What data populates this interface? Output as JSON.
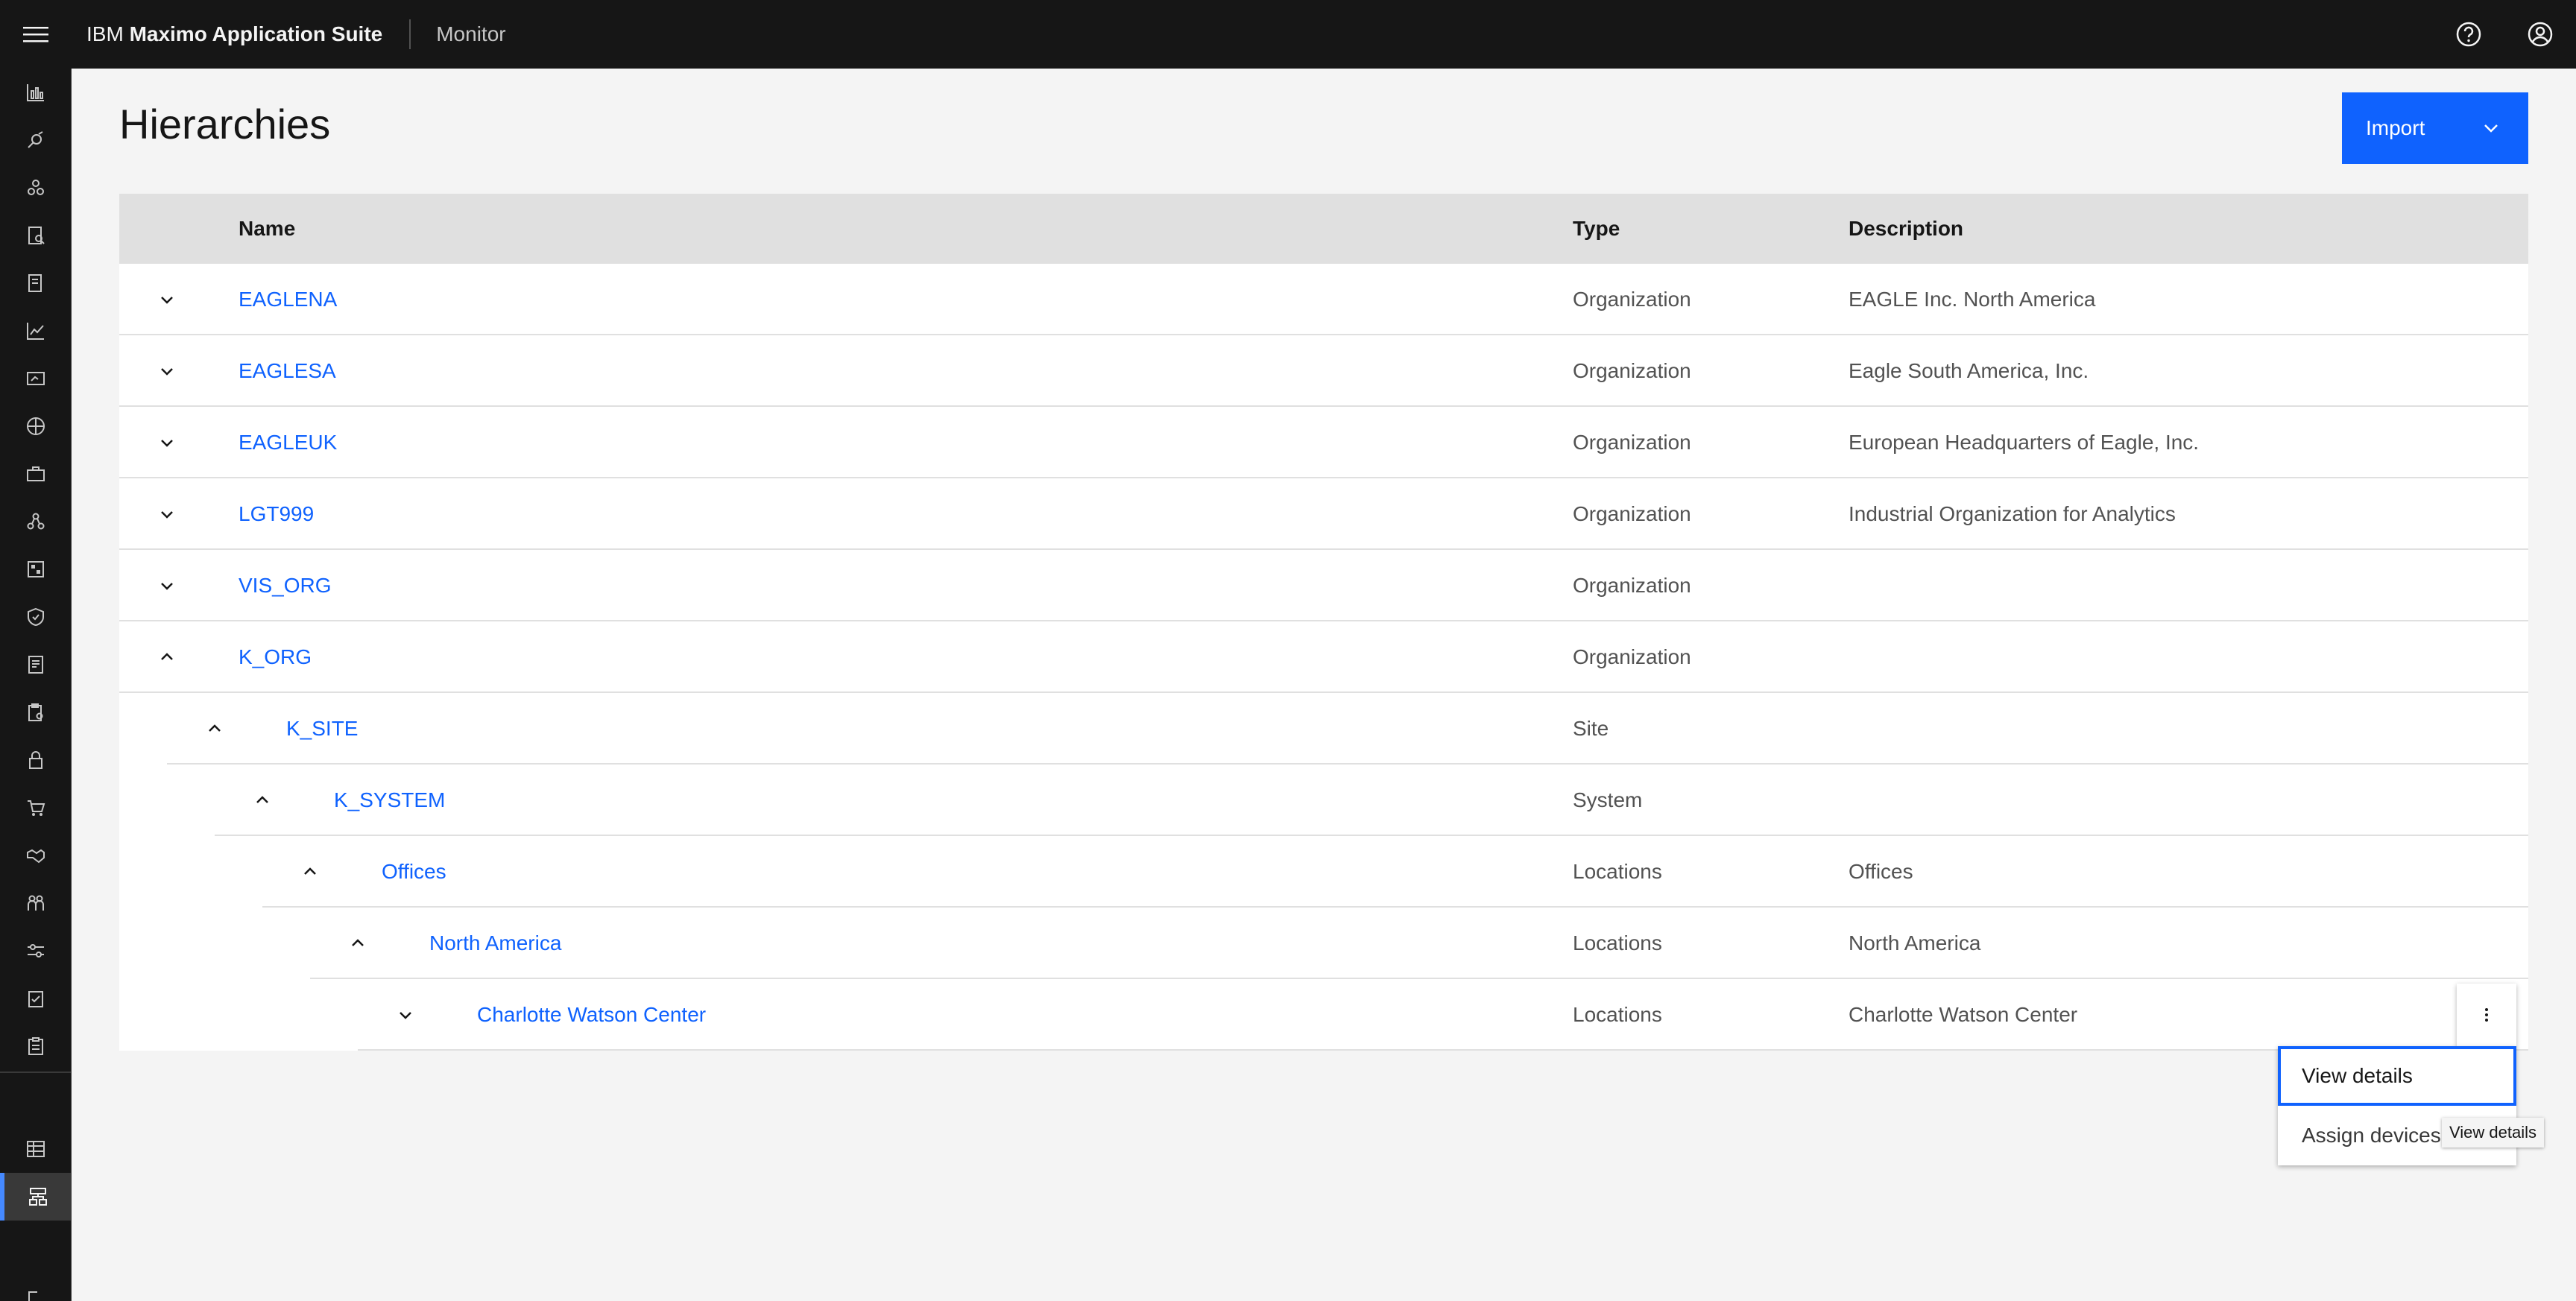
{
  "header": {
    "brand_prefix": "IBM",
    "brand_name": "Maximo Application Suite",
    "app_name": "Monitor",
    "icons": [
      "menu-icon",
      "help-icon",
      "user-avatar-icon"
    ]
  },
  "sidenav": {
    "icons": [
      "analytics-icon",
      "satellite-icon",
      "asset-icon",
      "inspection-icon",
      "report-icon",
      "chart-line-icon",
      "dashboard-icon",
      "network-icon",
      "tool-kit-icon",
      "model-icon",
      "grid-icon",
      "security-icon",
      "document-icon",
      "clipboard-icon",
      "lock-icon",
      "cart-icon",
      "handshake-icon",
      "people-icon",
      "settings-adjust-icon",
      "checklist-icon",
      "task-icon",
      "data-table-icon",
      "hierarchy-icon",
      "logout-icon"
    ],
    "active": "hierarchy-icon"
  },
  "page": {
    "title": "Hierarchies",
    "import_label": "Import"
  },
  "table": {
    "columns": {
      "name": "Name",
      "type": "Type",
      "description": "Description"
    },
    "rows": [
      {
        "name": "EAGLENA",
        "type": "Organization",
        "description": "EAGLE Inc. North America",
        "expanded": false,
        "level": 0
      },
      {
        "name": "EAGLESA",
        "type": "Organization",
        "description": "Eagle South America, Inc.",
        "expanded": false,
        "level": 0
      },
      {
        "name": "EAGLEUK",
        "type": "Organization",
        "description": "European Headquarters of Eagle, Inc.",
        "expanded": false,
        "level": 0
      },
      {
        "name": "LGT999",
        "type": "Organization",
        "description": "Industrial Organization for Analytics",
        "expanded": false,
        "level": 0
      },
      {
        "name": "VIS_ORG",
        "type": "Organization",
        "description": "",
        "expanded": false,
        "level": 0
      },
      {
        "name": "K_ORG",
        "type": "Organization",
        "description": "",
        "expanded": true,
        "level": 0
      },
      {
        "name": "K_SITE",
        "type": "Site",
        "description": "",
        "expanded": true,
        "level": 1
      },
      {
        "name": "K_SYSTEM",
        "type": "System",
        "description": "",
        "expanded": true,
        "level": 2
      },
      {
        "name": "Offices",
        "type": "Locations",
        "description": "Offices",
        "expanded": true,
        "level": 3
      },
      {
        "name": "North America",
        "type": "Locations",
        "description": "North America",
        "expanded": true,
        "level": 4
      },
      {
        "name": "Charlotte Watson Center",
        "type": "Locations",
        "description": "Charlotte Watson Center",
        "expanded": false,
        "level": 5
      }
    ]
  },
  "overflow_menu": {
    "items": [
      "View details",
      "Assign devices"
    ],
    "tooltip": "View details"
  },
  "colors": {
    "header_bg": "#161616",
    "link": "#0f62fe",
    "primary_button": "#0f62fe",
    "table_header_bg": "#e0e0e0",
    "page_bg": "#f4f4f4"
  }
}
